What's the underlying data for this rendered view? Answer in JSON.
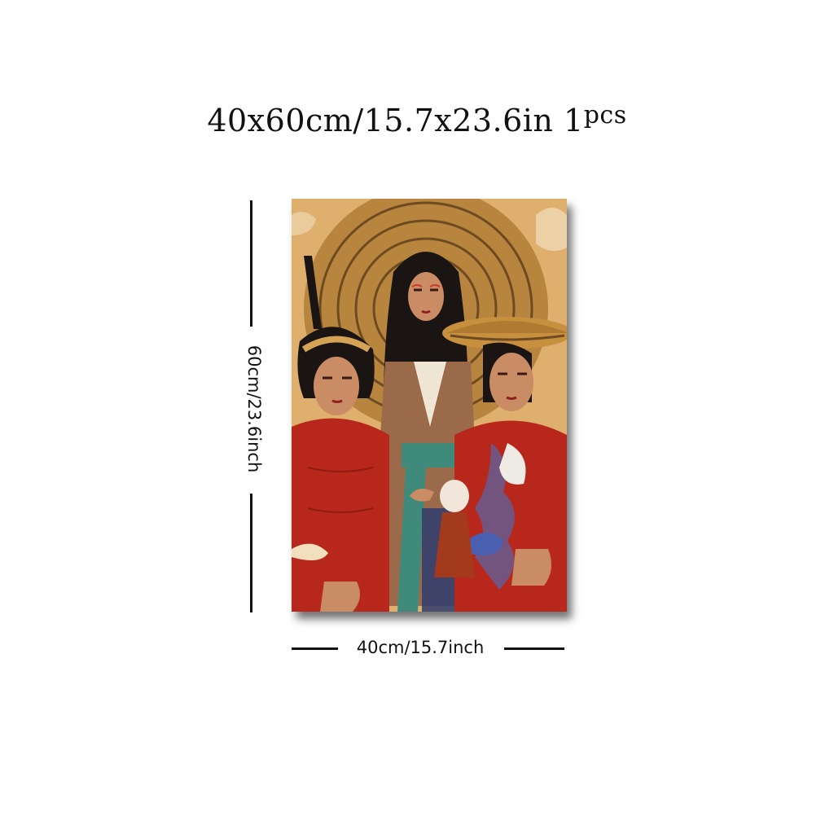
{
  "product": {
    "size_title": "40x60cm/15.7x23.6in",
    "quantity_number": "1",
    "quantity_unit": "pcs"
  },
  "dimensions": {
    "height_label": "60cm/23.6inch",
    "width_label": "40cm/15.7inch"
  },
  "artwork": {
    "subject": "three women in traditional dress",
    "colors": {
      "background": "#d9a55e",
      "hat": "#b8853f",
      "red_dress": "#b8271c",
      "brown_robe": "#9a6a4a",
      "teal_sash": "#3f8a7a",
      "hair": "#1a1412"
    }
  }
}
